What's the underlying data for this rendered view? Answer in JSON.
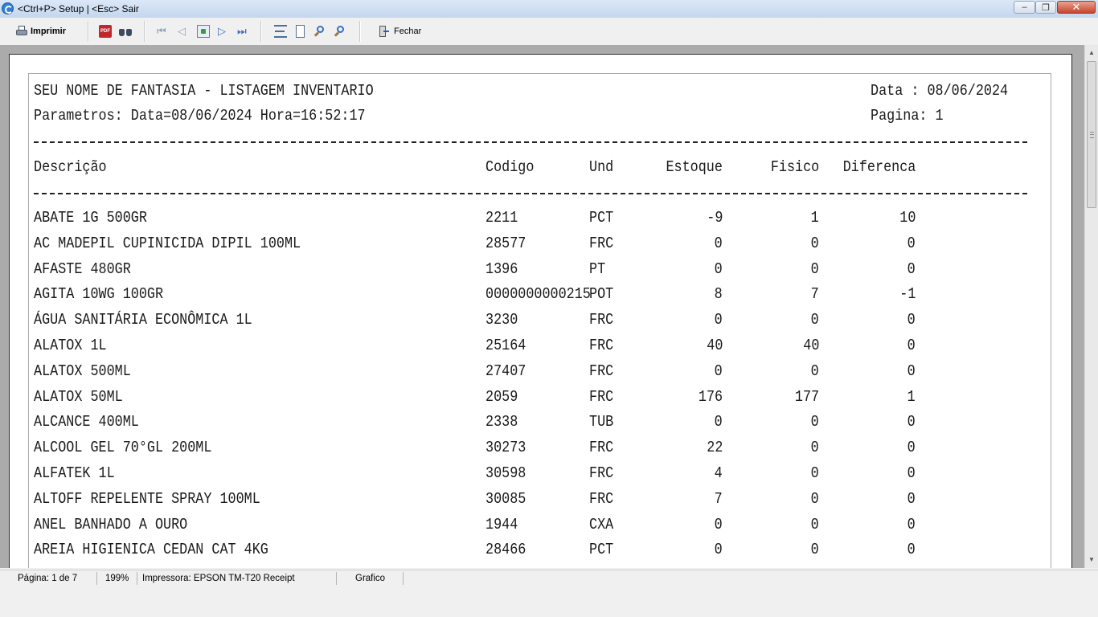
{
  "window": {
    "title": "<Ctrl+P> Setup | <Esc> Sair",
    "minimize_glyph": "‒",
    "maximize_glyph": "❐",
    "close_glyph": "✕"
  },
  "toolbar": {
    "print_label": "Imprimir",
    "pdf_icon_text": "PDF",
    "close_label": "Fechar",
    "nav_first": "⏮",
    "nav_prev": "◁",
    "nav_next": "▷",
    "nav_last": "⏭"
  },
  "report": {
    "title": "SEU NOME DE FANTASIA - LISTAGEM INVENTARIO",
    "params": "Parametros: Data=08/06/2024 Hora=16:52:17",
    "date_text": "Data  : 08/06/2024",
    "page_text": "Pagina: 1",
    "columns": {
      "descricao": "Descrição",
      "codigo": "Codigo",
      "und": "Und",
      "estoque": "Estoque",
      "fisico": "Fisico",
      "diferenca": "Diferenca"
    },
    "rows": [
      {
        "desc": "ABATE 1G 500GR",
        "code": "2211",
        "und": "PCT",
        "estoque": "-9",
        "fisico": "1",
        "dif": "10"
      },
      {
        "desc": "AC MADEPIL CUPINICIDA DIPIL 100ML",
        "code": "28577",
        "und": "FRC",
        "estoque": "0",
        "fisico": "0",
        "dif": "0"
      },
      {
        "desc": "AFASTE 480GR",
        "code": "1396",
        "und": "PT",
        "estoque": "0",
        "fisico": "0",
        "dif": "0"
      },
      {
        "desc": "AGITA 10WG 100GR",
        "code": "0000000000215",
        "und": "POT",
        "estoque": "8",
        "fisico": "7",
        "dif": "-1"
      },
      {
        "desc": "ÁGUA SANITÁRIA ECONÔMICA 1L",
        "code": "3230",
        "und": "FRC",
        "estoque": "0",
        "fisico": "0",
        "dif": "0"
      },
      {
        "desc": "ALATOX 1L",
        "code": "25164",
        "und": "FRC",
        "estoque": "40",
        "fisico": "40",
        "dif": "0"
      },
      {
        "desc": "ALATOX 500ML",
        "code": "27407",
        "und": "FRC",
        "estoque": "0",
        "fisico": "0",
        "dif": "0"
      },
      {
        "desc": "ALATOX 50ML",
        "code": "2059",
        "und": "FRC",
        "estoque": "176",
        "fisico": "177",
        "dif": "1"
      },
      {
        "desc": "ALCANCE 400ML",
        "code": "2338",
        "und": "TUB",
        "estoque": "0",
        "fisico": "0",
        "dif": "0"
      },
      {
        "desc": "ALCOOL GEL 70°GL 200ML",
        "code": "30273",
        "und": "FRC",
        "estoque": "22",
        "fisico": "0",
        "dif": "0"
      },
      {
        "desc": "ALFATEK 1L",
        "code": "30598",
        "und": "FRC",
        "estoque": "4",
        "fisico": "0",
        "dif": "0"
      },
      {
        "desc": "ALTOFF REPELENTE SPRAY 100ML",
        "code": "30085",
        "und": "FRC",
        "estoque": "7",
        "fisico": "0",
        "dif": "0"
      },
      {
        "desc": "ANEL BANHADO A OURO",
        "code": "1944",
        "und": "CXA",
        "estoque": "0",
        "fisico": "0",
        "dif": "0"
      },
      {
        "desc": "AREIA HIGIENICA CEDAN CAT 4KG",
        "code": "28466",
        "und": "PCT",
        "estoque": "0",
        "fisico": "0",
        "dif": "0"
      }
    ]
  },
  "scrollbar": {
    "up_glyph": "▲",
    "down_glyph": "▼"
  },
  "status": {
    "page": "Página: 1 de 7",
    "zoom": "199%",
    "printer": "Impressora: EPSON TM-T20 Receipt",
    "mode": "Grafico"
  }
}
